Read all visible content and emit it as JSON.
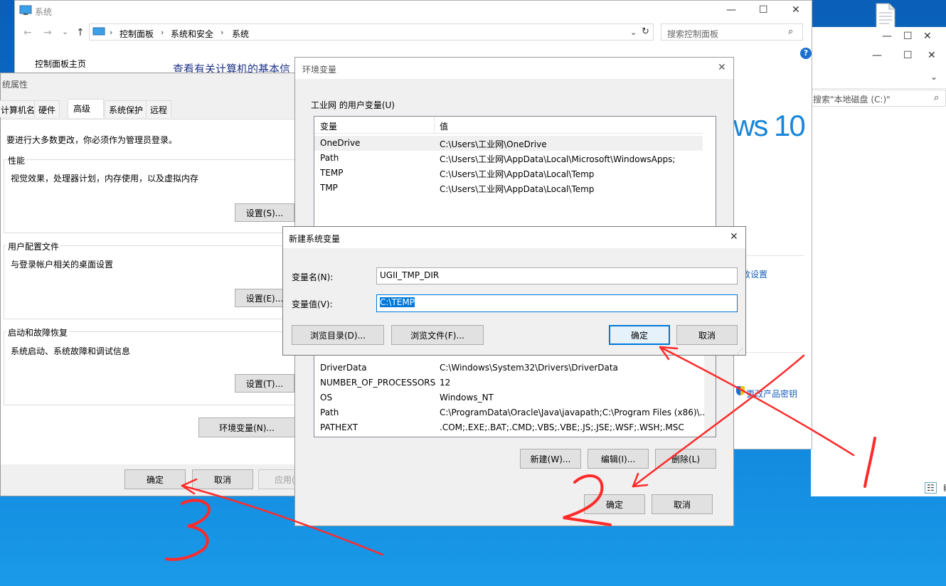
{
  "desktop": {
    "taskbar_icons": [
      "list-view-icon",
      "details-view-icon"
    ]
  },
  "system_window": {
    "title": "系统",
    "breadcrumb": [
      "控制面板",
      "系统和安全",
      "系统"
    ],
    "search_placeholder": "搜索控制面板",
    "left_link": "控制面板主页",
    "heading": "查看有关计算机的基本信",
    "windows_brand": "ws 10",
    "change_settings_link": "改设置",
    "change_key_link": "更改产品密钥"
  },
  "explorer_window": {
    "search_placeholder": "搜索\"本地磁盘 (C:)\""
  },
  "sys_props": {
    "title": "统属性",
    "tabs": [
      "计算机名",
      "硬件",
      "高级",
      "系统保护",
      "远程"
    ],
    "active_tab": 2,
    "admin_note": "要进行大多数更改，你必须作为管理员登录。",
    "perf": {
      "title": "性能",
      "desc": "视觉效果，处理器计划，内存使用，以及虚拟内存",
      "button": "设置(S)..."
    },
    "profile": {
      "title": "用户配置文件",
      "desc": "与登录帐户相关的桌面设置",
      "button": "设置(E)..."
    },
    "startup": {
      "title": "启动和故障恢复",
      "desc": "系统启动、系统故障和调试信息",
      "button": "设置(T)..."
    },
    "env_button": "环境变量(N)...",
    "ok": "确定",
    "cancel": "取消",
    "apply": "应用(A)"
  },
  "env_vars": {
    "title": "环境变量",
    "user_section": "工业网 的用户变量(U)",
    "col_var": "变量",
    "col_val": "值",
    "user_rows": [
      {
        "name": "OneDrive",
        "value": "C:\\Users\\工业网\\OneDrive"
      },
      {
        "name": "Path",
        "value": "C:\\Users\\工业网\\AppData\\Local\\Microsoft\\WindowsApps;"
      },
      {
        "name": "TEMP",
        "value": "C:\\Users\\工业网\\AppData\\Local\\Temp"
      },
      {
        "name": "TMP",
        "value": "C:\\Users\\工业网\\AppData\\Local\\Temp"
      }
    ],
    "system_rows": [
      {
        "name": "DriverData",
        "value": "C:\\Windows\\System32\\Drivers\\DriverData"
      },
      {
        "name": "NUMBER_OF_PROCESSORS",
        "value": "12"
      },
      {
        "name": "OS",
        "value": "Windows_NT"
      },
      {
        "name": "Path",
        "value": "C:\\ProgramData\\Oracle\\Java\\javapath;C:\\Program Files (x86)\\..."
      },
      {
        "name": "PATHEXT",
        "value": ".COM;.EXE;.BAT;.CMD;.VBS;.VBE;.JS;.JSE;.WSF;.WSH;.MSC"
      }
    ],
    "new_btn": "新建(W)...",
    "edit_btn": "编辑(I)...",
    "delete_btn": "删除(L)",
    "ok": "确定",
    "cancel": "取消"
  },
  "new_var_dialog": {
    "title": "新建系统变量",
    "name_label": "变量名(N):",
    "name_value": "UGII_TMP_DIR",
    "value_label": "变量值(V):",
    "value_value": "C:\\TEMP",
    "browse_dir": "浏览目录(D)...",
    "browse_file": "浏览文件(F)...",
    "ok": "确定",
    "cancel": "取消"
  },
  "annotations": {
    "step1": "1",
    "step2": "2",
    "step3": "3",
    "color": "#ff2a2a"
  }
}
